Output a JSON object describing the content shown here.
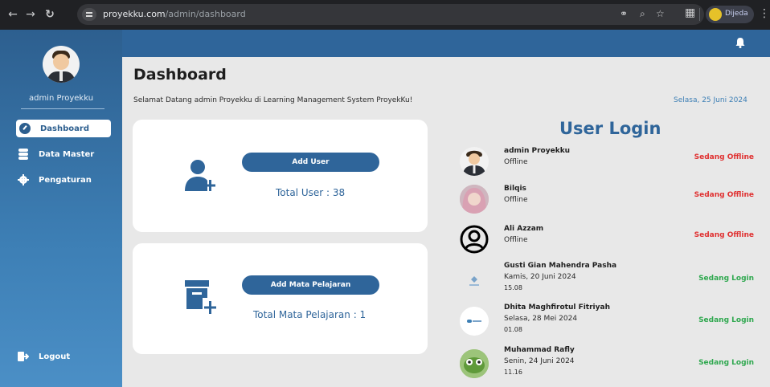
{
  "browser": {
    "url_domain": "proyekku.com",
    "url_path": "/admin/dashboard",
    "profile_name": "Dijeda"
  },
  "sidebar": {
    "user_name": "admin Proyekku",
    "items": [
      {
        "label": "Dashboard",
        "icon": "dashboard-icon",
        "active": true
      },
      {
        "label": "Data Master",
        "icon": "database-icon",
        "active": false
      },
      {
        "label": "Pengaturan",
        "icon": "gear-icon",
        "active": false
      }
    ],
    "logout_label": "Logout"
  },
  "header": {
    "title": "Dashboard",
    "welcome": "Selamat Datang admin Proyekku di Learning Management System ProyekKu!",
    "date": "Selasa, 25 Juni 2024"
  },
  "cards": {
    "user": {
      "button_label": "Add User",
      "total": "Total User : 38"
    },
    "mapel": {
      "button_label": "Add Mata Pelajaran",
      "total": "Total Mata Pelajaran : 1"
    }
  },
  "user_login": {
    "title": "User Login",
    "users": [
      {
        "name": "admin Proyekku",
        "status": "Offline",
        "time": "",
        "label": "Sedang Offline",
        "online": false
      },
      {
        "name": "Bilqis",
        "status": "Offline",
        "time": "",
        "label": "Sedang Offline",
        "online": false
      },
      {
        "name": "Ali Azzam",
        "status": "Offline",
        "time": "",
        "label": "Sedang Offline",
        "online": false
      },
      {
        "name": "Gusti Gian Mahendra Pasha",
        "status": "Kamis, 20 Juni 2024",
        "time": "15.08",
        "label": "Sedang Login",
        "online": true
      },
      {
        "name": "Dhita Maghfirotul Fitriyah",
        "status": "Selasa, 28 Mei 2024",
        "time": "01.08",
        "label": "Sedang Login",
        "online": true
      },
      {
        "name": "Muhammad Rafly",
        "status": "Senin, 24 Juni 2024",
        "time": "11.16",
        "label": "Sedang Login",
        "online": true
      }
    ]
  },
  "colors": {
    "primary": "#2f659a",
    "offline": "#e03131",
    "online": "#2fa84f"
  }
}
